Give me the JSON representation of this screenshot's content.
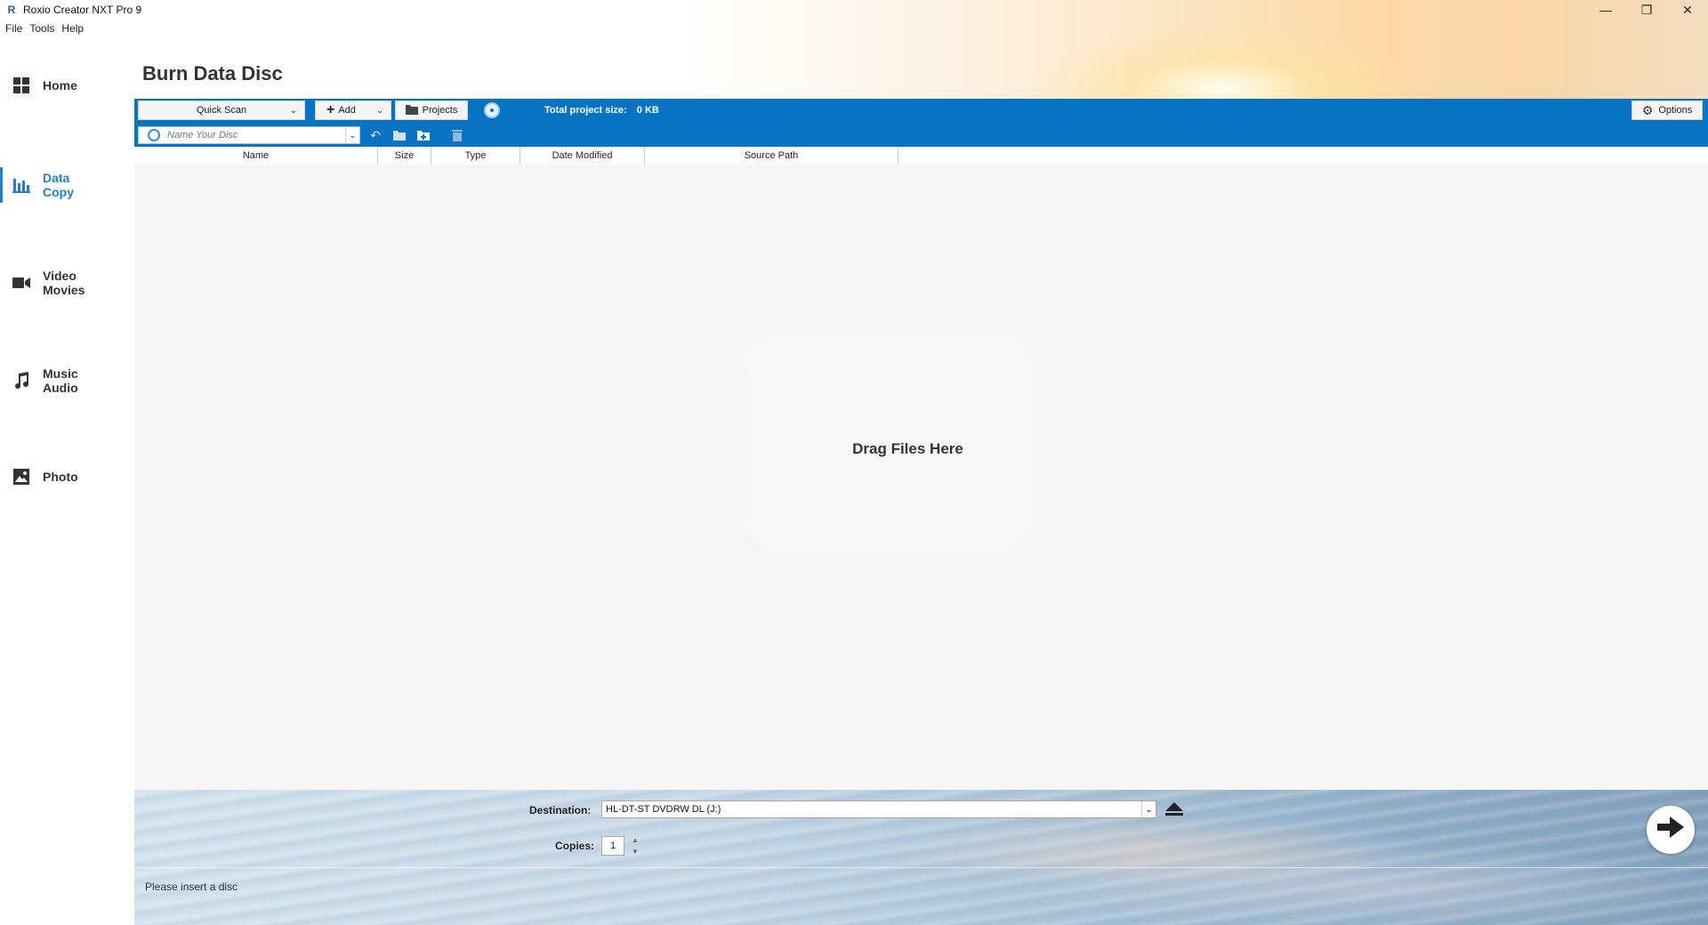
{
  "window": {
    "title": "Roxio Creator NXT Pro 9",
    "app_icon": "R",
    "controls": {
      "minimize": "—",
      "restore": "❐",
      "close": "✕"
    }
  },
  "menu": [
    "File",
    "Tools",
    "Help"
  ],
  "sidebar": {
    "items": [
      {
        "id": "home",
        "label": "Home",
        "icon": "grid-icon",
        "active": false
      },
      {
        "id": "data-copy",
        "label_line1": "Data",
        "label_line2": "Copy",
        "icon": "chart-icon",
        "active": true
      },
      {
        "id": "video-movies",
        "label_line1": "Video",
        "label_line2": "Movies",
        "icon": "video-camera-icon",
        "active": false
      },
      {
        "id": "music-audio",
        "label_line1": "Music",
        "label_line2": "Audio",
        "icon": "music-note-icon",
        "active": false
      },
      {
        "id": "photo",
        "label": "Photo",
        "icon": "image-icon",
        "active": false
      }
    ],
    "accent": "#2280c8"
  },
  "page": {
    "title": "Burn Data Disc"
  },
  "toolbar": {
    "scan_mode": "Quick Scan",
    "add_label": "Add",
    "projects_label": "Projects",
    "total_size_label": "Total project size:",
    "total_size_value": "0 KB",
    "options_label": "Options",
    "disc_name_placeholder": "Name Your Disc",
    "bg_color": "#0a74c4"
  },
  "table": {
    "columns": [
      "Name",
      "Size",
      "Type",
      "Date Modified",
      "Source Path"
    ],
    "rows": []
  },
  "drop_zone": {
    "text": "Drag Files Here"
  },
  "bottom": {
    "destination_label": "Destination:",
    "destination_value": "HL-DT-ST DVDRW DL (J:)",
    "copies_label": "Copies:",
    "copies_value": "1",
    "status_text": "Please insert a disc"
  }
}
